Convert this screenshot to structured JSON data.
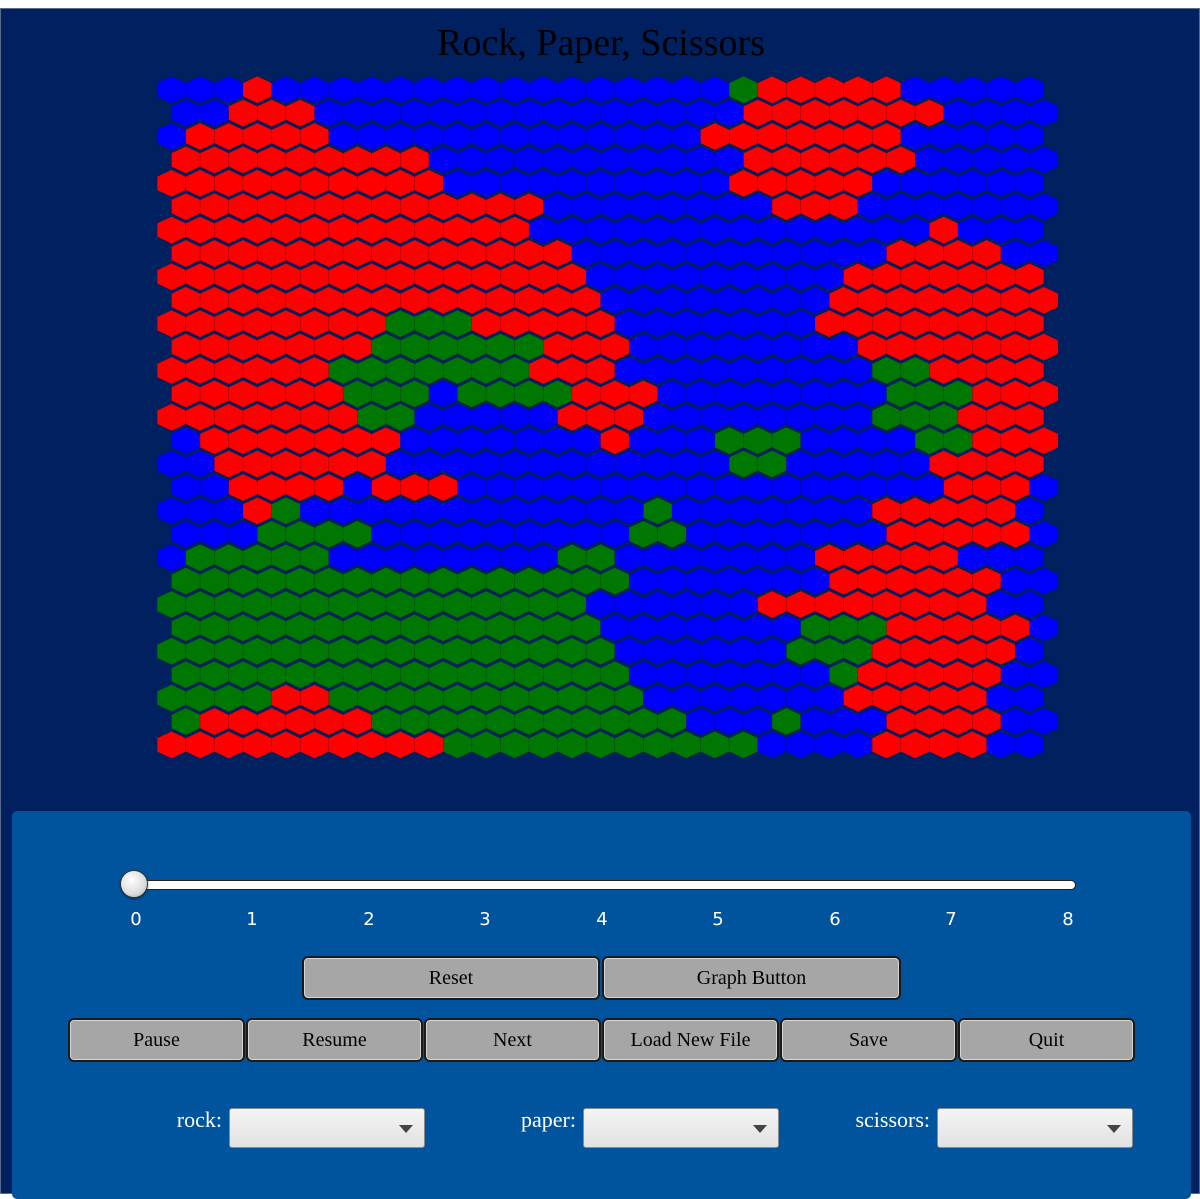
{
  "app": {
    "title": "Rock, Paper, Scissors"
  },
  "board": {
    "cols": 31,
    "rows": 29,
    "colors": {
      "R": "#ff0000",
      "B": "#0000ff",
      "G": "#007700"
    },
    "cells": [
      "BBBRBBBBBBBBBBBBBBBBGRRRRRBBBBB",
      "BBRRRBBBBBBBBBBBBBBBRRRRRRRBBBB",
      "BRRRRRBBBBBBBBBBBBBRRRRRRRBBBBB",
      "RRRRRRRRRBBBBBBBBBBBRRRRRRBBBBB",
      "RRRRRRRRRRBBBBBBBBBBRRRRRBBBBBB",
      "RRRRRRRRRRRRRBBBBBBBBRRRBBBBBBB",
      "RRRRRRRRRRRRRBBBBBBBBBBBBBBRBBB",
      "RRRRRRRRRRRRRRBBBBBBBBBBBRRRRBB",
      "RRRRRRRRRRRRRRRBBBBBBBBBRRRRRRR",
      "RRRRRRRRRRRRRRRBBBBBBBBRRRRRRRR",
      "RRRRRRRRGGGRRRRRBBBBBBBRRRRRRRR",
      "RRRRRRRGGGGGGRRRBBBBBBBBRRRRRRR",
      "RRRRRRGGGGGGGRRRBBBBBBBBBGGRRRR",
      "RRRRRRGGGBGGGGRRRBBBBBBBBGGGRRR",
      "RRRRRRRGGBBBBBRRRBBBBBBBBGGGRRR",
      "BRRRRRRRBBBBBBBRBBBGGGBBBBGGRRR",
      "BBRRRRRRBBBBBBBBBBBBGGBBBBBRRRR",
      "BBRRRRBRRRBBBBBBBBBBBBBBBBBRRRB",
      "BBBRGBBBBBBBBBBBBGBBBBBBBRRRRRB",
      "BBBGGGGBBBBBBBBBGGBBBBBBBRRRRRB",
      "BGGGGGBBBBBBBBGGBBBBBBBRRRRRBBB",
      "GGGGGGGGGGGGGGGGBBBBBBBRRRRRRBB",
      "GGGGGGGGGGGGGGGBBBBBBRRRRRRRRBB",
      "GGGGGGGGGGGGGGGBBBBBBBGGGRRRRRB",
      "GGGGGGGGGGGGGGGGBBBBBBGGGRRRRRB",
      "GGGGGGGGGGGGGGGGBBBBBBBGRRRRRBB",
      "GGGGRRGGGGGGGGGGGBBBBBBBRRRRRBB",
      "GRRRRRRGGGGGGGGGGGBBBGBBBRRRRBB",
      "RRRRRRRRRRGGGGGGGGGGGBBBBRRRRBB"
    ]
  },
  "slider": {
    "min": 0,
    "max": 8,
    "value": 0,
    "ticks": [
      "0",
      "1",
      "2",
      "3",
      "4",
      "5",
      "6",
      "7",
      "8"
    ]
  },
  "buttons": {
    "reset": "Reset",
    "graph": "Graph Button",
    "pause": "Pause",
    "resume": "Resume",
    "next": "Next",
    "load": "Load New File",
    "save": "Save",
    "quit": "Quit"
  },
  "selectors": {
    "rock_label": "rock:",
    "paper_label": "paper:",
    "scissors_label": "scissors:",
    "rock_value": "",
    "paper_value": "",
    "scissors_value": ""
  }
}
